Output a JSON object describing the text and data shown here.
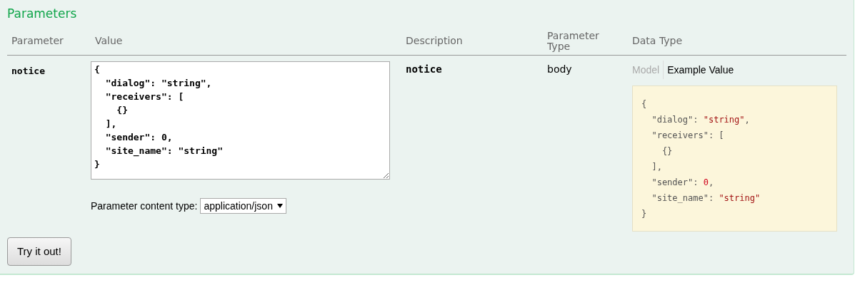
{
  "title": "Parameters",
  "columns": [
    "Parameter",
    "Value",
    "Description",
    "Parameter\nType",
    "Data Type"
  ],
  "rows": [
    {
      "parameter": "notice",
      "value": "{\n  \"dialog\": \"string\",\n  \"receivers\": [\n    {}\n  ],\n  \"sender\": 0,\n  \"site_name\": \"string\"\n}",
      "content_type_label": "Parameter content type:",
      "content_type": "application/json",
      "description": "notice",
      "parameter_type": "body",
      "data_type_tabs": [
        {
          "label": "Model",
          "selected": false
        },
        {
          "label": "Example Value",
          "selected": true
        }
      ],
      "example_lines": [
        [
          {
            "kind": "punct",
            "text": "{"
          }
        ],
        [
          {
            "kind": "key",
            "text": "  \"dialog\""
          },
          {
            "kind": "punct",
            "text": ": "
          },
          {
            "kind": "string",
            "text": "\"string\""
          },
          {
            "kind": "punct",
            "text": ","
          }
        ],
        [
          {
            "kind": "key",
            "text": "  \"receivers\""
          },
          {
            "kind": "punct",
            "text": ": ["
          }
        ],
        [
          {
            "kind": "punct",
            "text": "    {}"
          }
        ],
        [
          {
            "kind": "punct",
            "text": "  ],"
          }
        ],
        [
          {
            "kind": "key",
            "text": "  \"sender\""
          },
          {
            "kind": "punct",
            "text": ": "
          },
          {
            "kind": "number",
            "text": "0"
          },
          {
            "kind": "punct",
            "text": ","
          }
        ],
        [
          {
            "kind": "key",
            "text": "  \"site_name\""
          },
          {
            "kind": "punct",
            "text": ": "
          },
          {
            "kind": "string",
            "text": "\"string\""
          }
        ],
        [
          {
            "kind": "punct",
            "text": "}"
          }
        ]
      ]
    }
  ],
  "button": "Try it out!"
}
